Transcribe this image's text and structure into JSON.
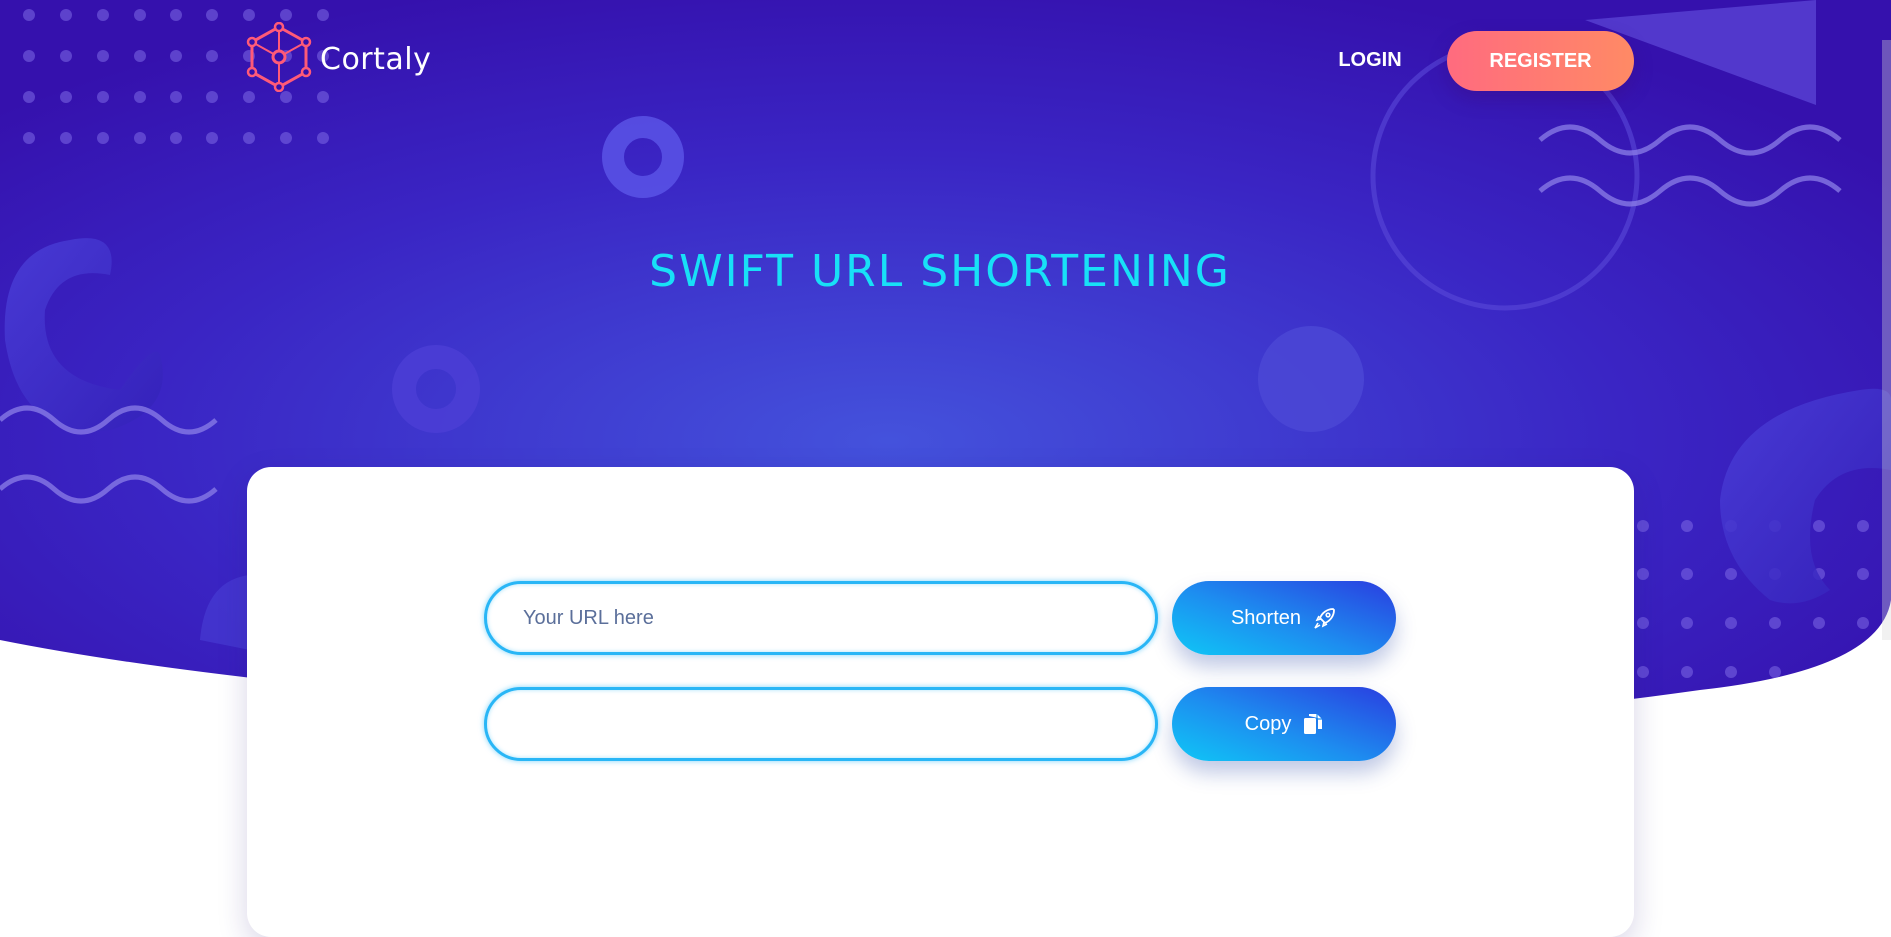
{
  "brand": {
    "name": "Cortaly"
  },
  "nav": {
    "login_label": "LOGIN",
    "register_label": "REGISTER"
  },
  "hero": {
    "title": "SWIFT URL SHORTENING"
  },
  "form": {
    "url_placeholder": "Your URL here",
    "url_value": "",
    "short_value": "",
    "shorten_label": "Shorten",
    "copy_label": "Copy"
  },
  "icons": {
    "logo": "hexagon-network-icon",
    "shorten": "rocket-icon",
    "copy": "copy-icon"
  },
  "colors": {
    "hero_top": "#3a12b5",
    "hero_center": "#4452dc",
    "headline": "#18e0f7",
    "register_start": "#ff6b7f",
    "register_end": "#ff8a65",
    "button_start": "#2a3de0",
    "button_end": "#0fc7f6",
    "input_border": "#29b6f6"
  }
}
